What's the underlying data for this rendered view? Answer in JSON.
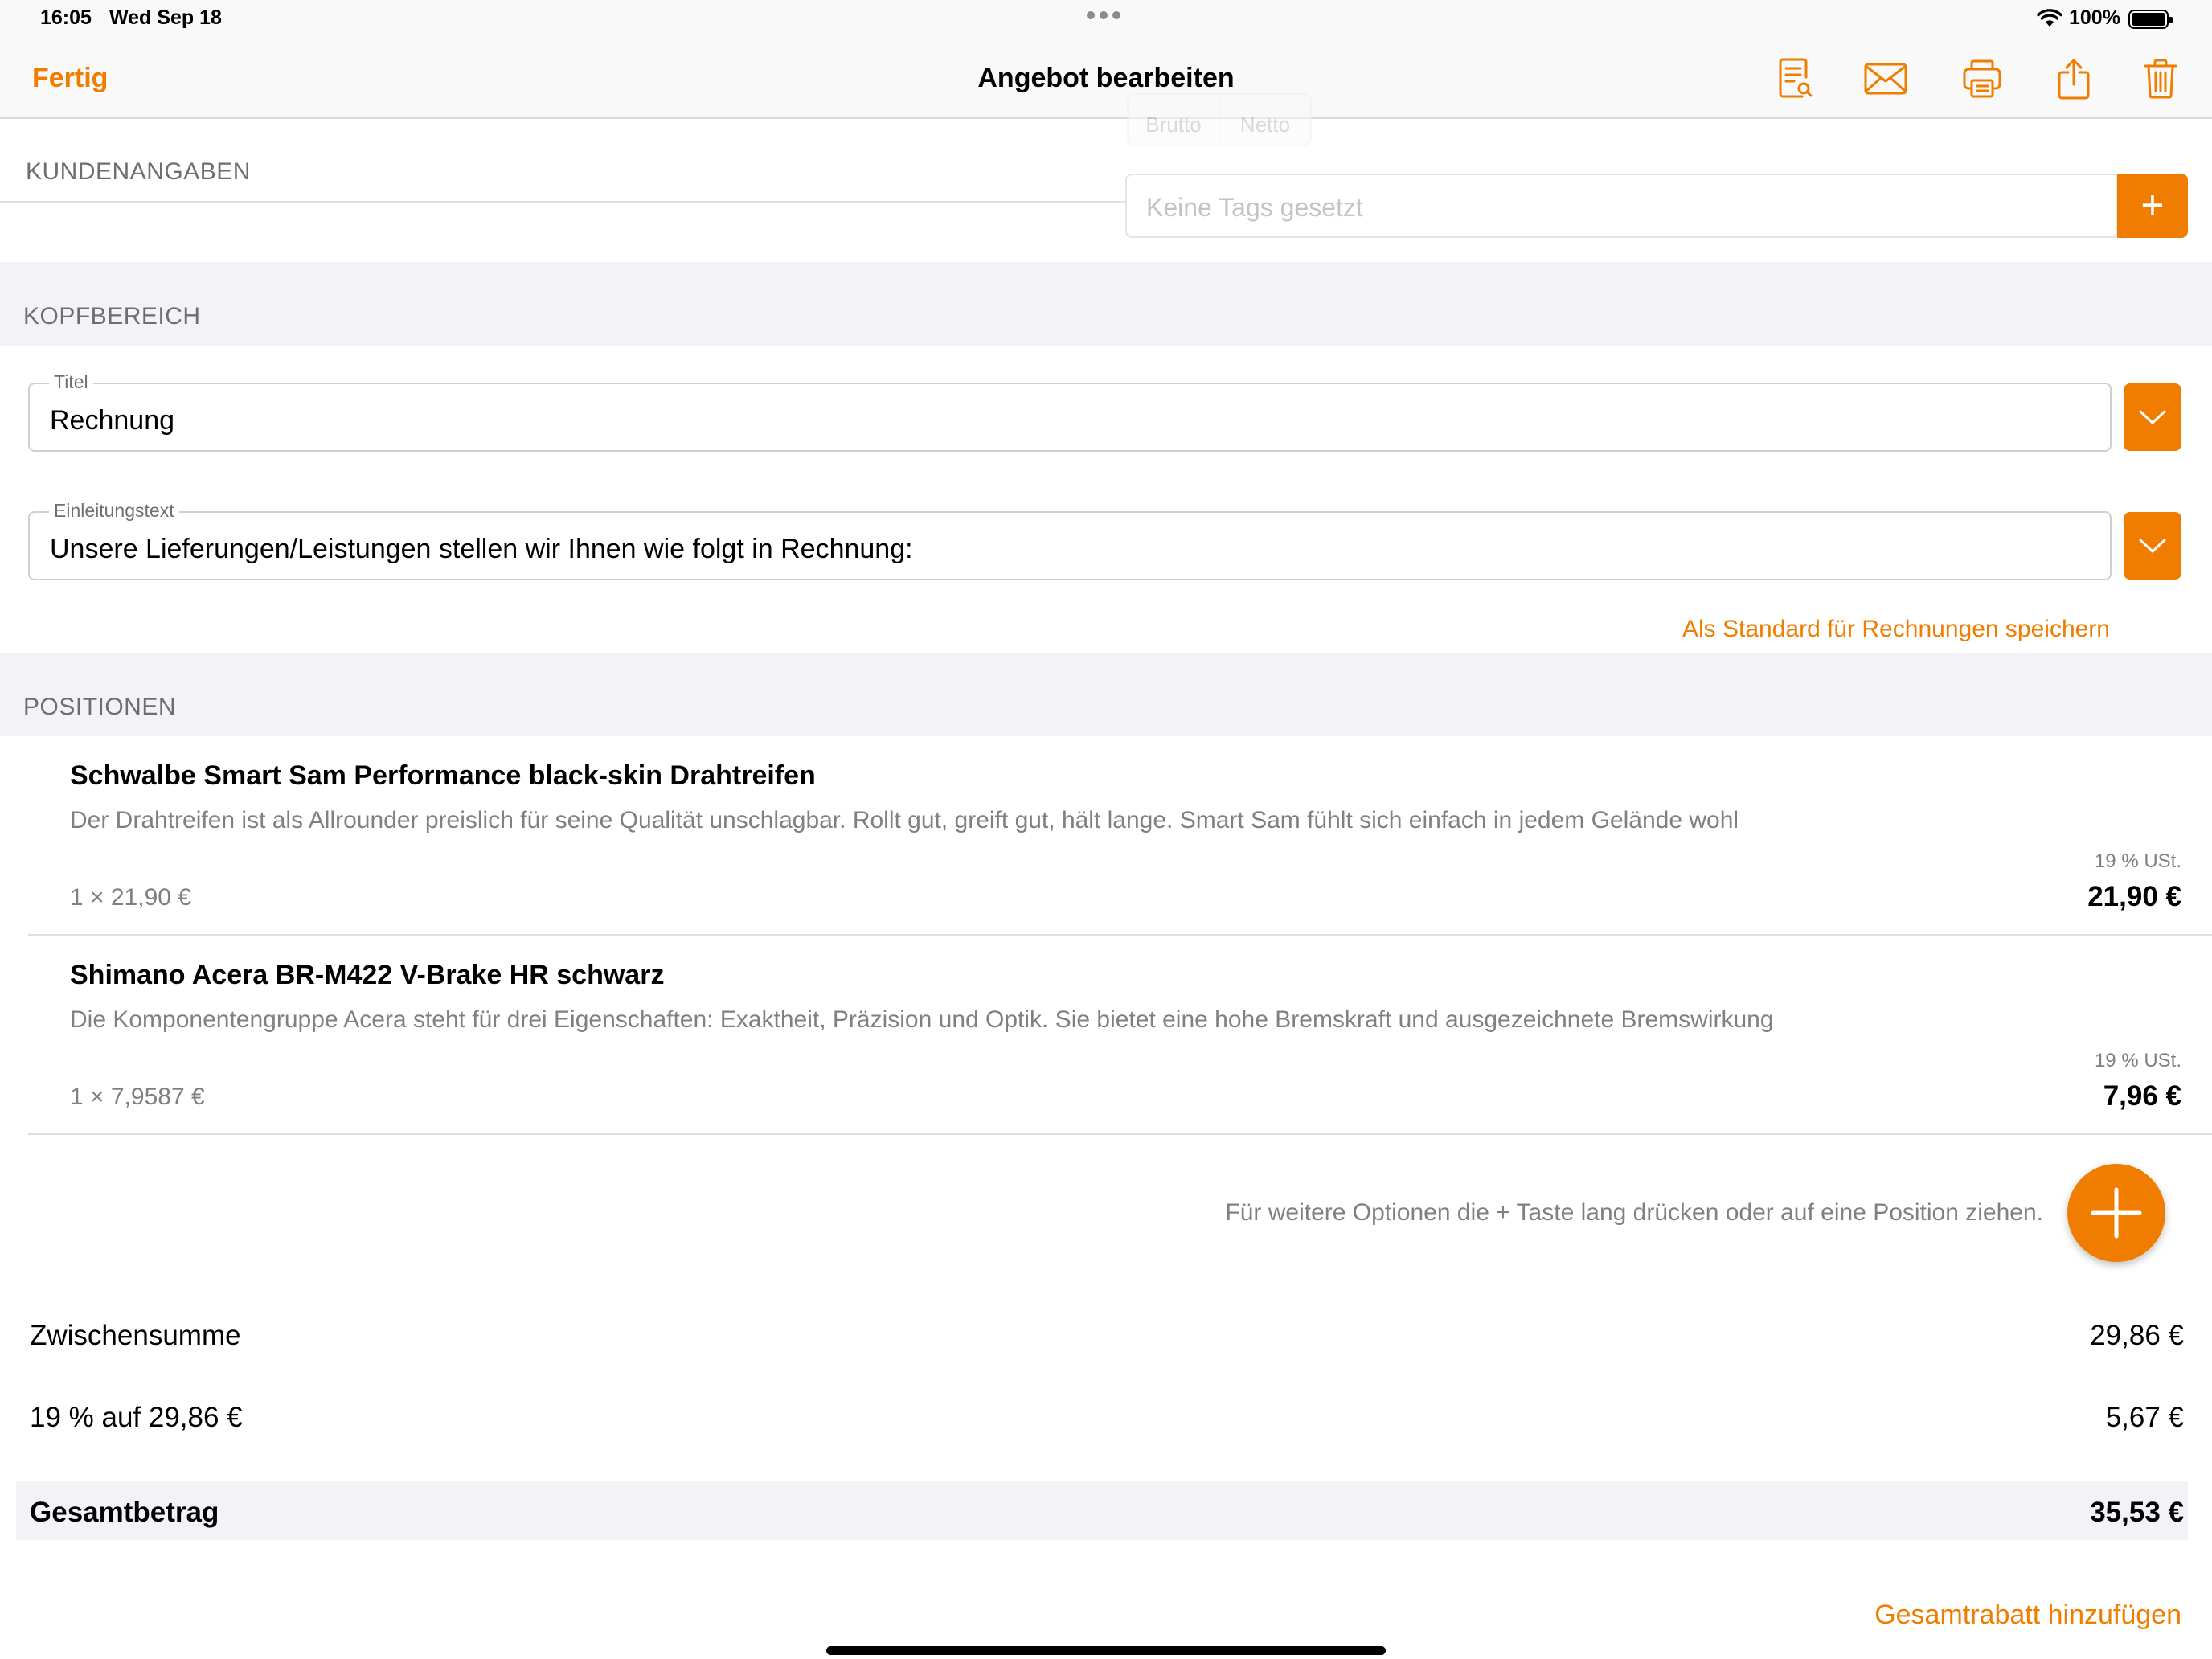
{
  "status_bar": {
    "time": "16:05",
    "date": "Wed Sep 18",
    "battery": "100%"
  },
  "nav": {
    "done_label": "Fertig",
    "title": "Angebot bearbeiten",
    "icons": [
      "document-preview-icon",
      "mail-icon",
      "printer-icon",
      "share-icon",
      "trash-icon"
    ]
  },
  "customer": {
    "section_label": "KUNDENANGABEN",
    "price_mode": [
      "Brutto",
      "Netto"
    ],
    "tags_placeholder": "Keine Tags gesetzt",
    "tags_add": "+"
  },
  "header_section": {
    "section_label": "KOPFBEREICH",
    "title_label": "Titel",
    "title_value": "Rechnung",
    "intro_label": "Einleitungstext",
    "intro_value": "Unsere Lieferungen/Leistungen stellen wir Ihnen wie folgt in Rechnung:",
    "save_default_link": "Als Standard für Rechnungen speichern"
  },
  "positions": {
    "section_label": "POSITIONEN",
    "items": [
      {
        "title": "Schwalbe Smart Sam Performance black-skin Drahtreifen",
        "description": "Der Drahtreifen ist als Allrounder preislich für seine Qualität unschlagbar. Rollt gut, greift gut, hält lange. Smart Sam fühlt sich einfach in jedem Gelände wohl",
        "quantity": "1 × 21,90 €",
        "tax": "19 % USt.",
        "price": "21,90 €"
      },
      {
        "title": "Shimano Acera BR-M422 V-Brake HR schwarz",
        "description": "Die Komponentengruppe Acera steht für drei Eigenschaften: Exaktheit, Präzision und Optik. Sie bietet eine hohe Bremskraft und ausgezeichnete Bremswirkung",
        "quantity": "1 × 7,9587 €",
        "tax": "19 % USt.",
        "price": "7,96 €"
      }
    ],
    "hint": "Für weitere Optionen die + Taste lang drücken oder auf eine Position ziehen."
  },
  "totals": {
    "subtotal_label": "Zwischensumme",
    "subtotal_value": "29,86 €",
    "vat_label": "19 % auf 29,86 €",
    "vat_value": "5,67 €",
    "total_label": "Gesamtbetrag",
    "total_value": "35,53 €",
    "discount_link": "Gesamtrabatt hinzufügen"
  },
  "colors": {
    "accent": "#f07d00",
    "section_bg": "#f2f2f7",
    "secondary_text": "#808080"
  }
}
